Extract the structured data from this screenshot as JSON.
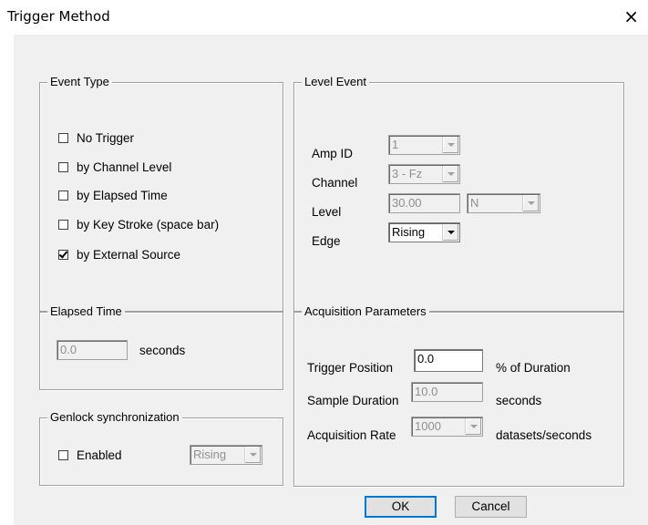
{
  "window": {
    "title": "Trigger Method",
    "close_glyph": "×"
  },
  "event_type": {
    "title": "Event Type",
    "options": [
      {
        "label": "No Trigger",
        "checked": false
      },
      {
        "label": "by Channel Level",
        "checked": false
      },
      {
        "label": "by Elapsed Time",
        "checked": false
      },
      {
        "label": "by Key Stroke (space bar)",
        "checked": false
      },
      {
        "label": "by External Source",
        "checked": true
      }
    ]
  },
  "level_event": {
    "title": "Level Event",
    "amp_id": {
      "label": "Amp ID",
      "value": "1"
    },
    "channel": {
      "label": "Channel",
      "value": "3 - Fz"
    },
    "level": {
      "label": "Level",
      "value": "30.00",
      "unit": "N"
    },
    "edge": {
      "label": "Edge",
      "value": "Rising"
    }
  },
  "elapsed_time": {
    "title": "Elapsed Time",
    "value": "0.0",
    "unit": "seconds"
  },
  "genlock": {
    "title": "Genlock synchronization",
    "enabled_label": "Enabled",
    "enabled": false,
    "edge_value": "Rising"
  },
  "acquisition": {
    "title": "Acquisition Parameters",
    "trigger_position": {
      "label": "Trigger Position",
      "value": "0.0",
      "unit": "% of Duration"
    },
    "sample_duration": {
      "label": "Sample Duration",
      "value": "10.0",
      "unit": "seconds"
    },
    "acquisition_rate": {
      "label": "Acquisition Rate",
      "value": "1000",
      "unit": "datasets/seconds"
    }
  },
  "buttons": {
    "ok": "OK",
    "cancel": "Cancel"
  }
}
